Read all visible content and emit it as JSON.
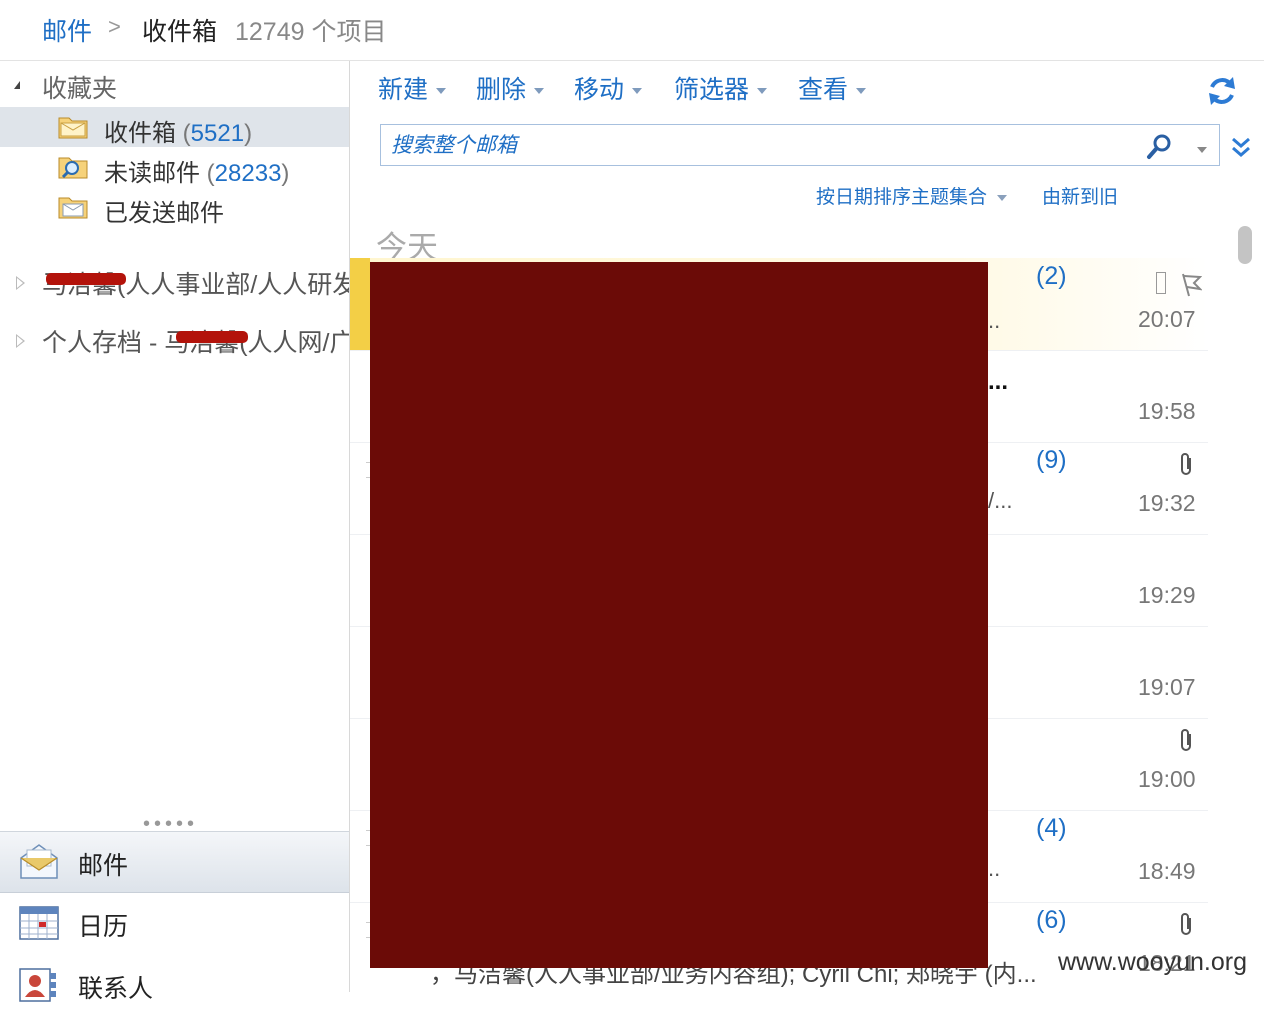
{
  "breadcrumb": {
    "root": "邮件",
    "separator": ">",
    "current": "收件箱",
    "item_count": "12749 个项目"
  },
  "favorites": {
    "header": "收藏夹",
    "items": [
      {
        "label": "收件箱",
        "count": "5521",
        "icon": "inbox-folder-icon",
        "selected": true
      },
      {
        "label": "未读邮件",
        "count": "28233",
        "icon": "search-folder-icon",
        "selected": false
      },
      {
        "label": "已发送邮件",
        "count": "",
        "icon": "sent-folder-icon",
        "selected": false
      }
    ]
  },
  "folder_groups": [
    {
      "label": "马洁馨(人人事业部/人人研发"
    },
    {
      "label": "个人存档 - 马洁馨(人人网/广"
    }
  ],
  "nav_sections": [
    {
      "label": "邮件",
      "icon": "mail-envelope-icon",
      "active": true
    },
    {
      "label": "日历",
      "icon": "calendar-icon",
      "active": false
    },
    {
      "label": "联系人",
      "icon": "contacts-icon",
      "active": false
    }
  ],
  "toolbar": {
    "new": "新建",
    "delete": "删除",
    "move": "移动",
    "filter": "筛选器",
    "view": "查看"
  },
  "search": {
    "placeholder": "搜索整个邮箱"
  },
  "sort": {
    "group_by": "按日期排序主题集合",
    "order": "由新到旧"
  },
  "list": {
    "day_header": "今天",
    "messages": [
      {
        "count": "(2)",
        "time": "20:07",
        "snippet": "..",
        "highlight": true,
        "flag": true,
        "attachment": false
      },
      {
        "count": "",
        "time": "19:58",
        "bold_snippet": "...",
        "highlight": false,
        "flag": false,
        "attachment": false
      },
      {
        "count": "(9)",
        "time": "19:32",
        "snippet": "/...",
        "highlight": false,
        "flag": false,
        "attachment": true
      },
      {
        "count": "",
        "time": "19:29",
        "snippet": "",
        "highlight": false,
        "flag": false,
        "attachment": false
      },
      {
        "count": "",
        "time": "19:07",
        "snippet": "",
        "highlight": false,
        "flag": false,
        "attachment": false
      },
      {
        "count": "",
        "time": "19:00",
        "snippet": "",
        "highlight": false,
        "flag": false,
        "attachment": true
      },
      {
        "count": "(4)",
        "time": "18:49",
        "snippet": "..",
        "highlight": false,
        "flag": false,
        "attachment": false
      },
      {
        "count": "(6)",
        "time": "18:21",
        "snippet": "",
        "highlight": false,
        "flag": false,
        "attachment": true
      }
    ],
    "bottom_fragment": "，马洁馨(人人事业部/业务内容组); Cyril Chi;  郑晓宇 (内..."
  },
  "watermark": "www.wooyun.org",
  "colors": {
    "accent_blue": "#1f6fc5",
    "redaction": "#6b0b07",
    "highlight_yellow": "#f3cf46",
    "selected_bg": "#dfe4ea"
  }
}
